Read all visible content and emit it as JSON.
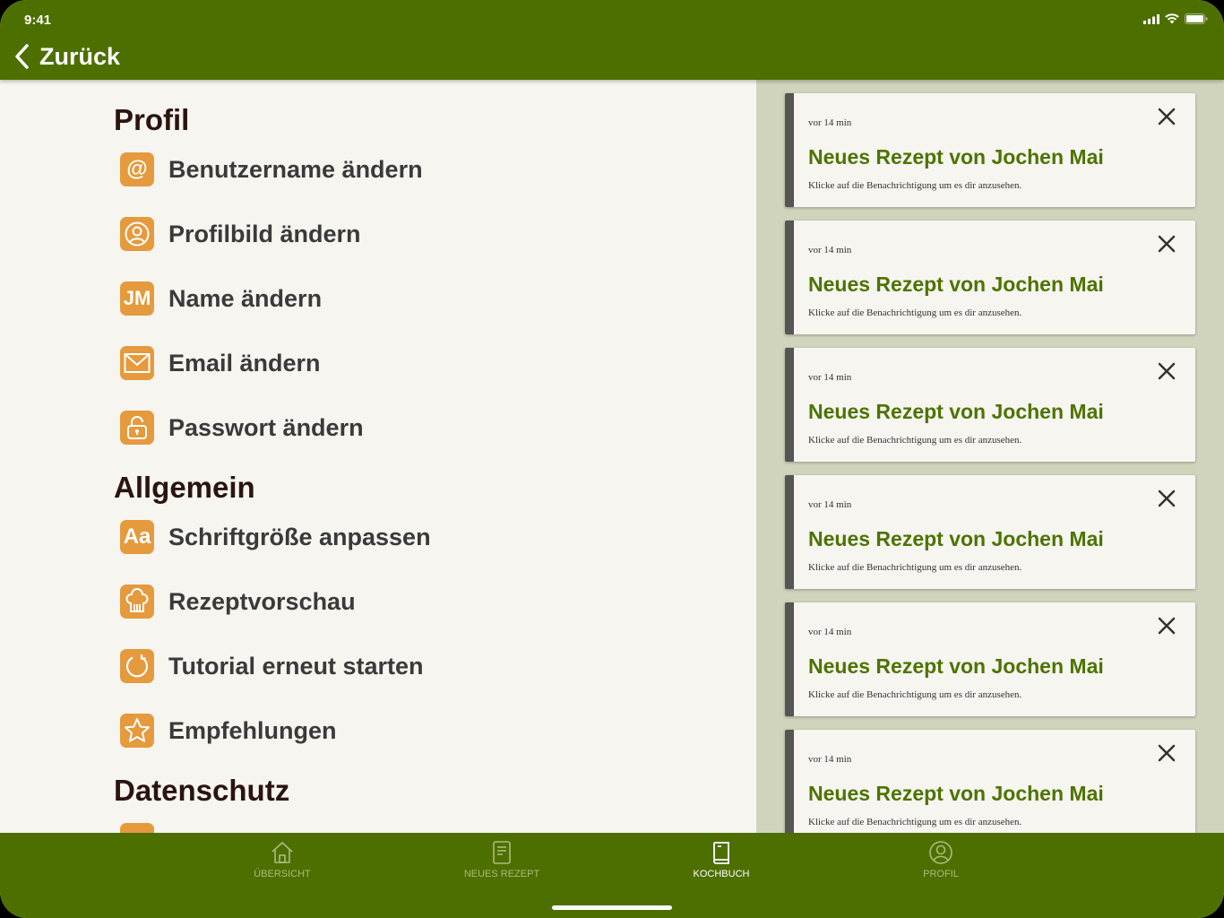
{
  "status_bar": {
    "time": "9:41"
  },
  "header": {
    "back_label": "Zurück"
  },
  "settings": {
    "sections": [
      {
        "title": "Profil"
      },
      {
        "title": "Allgemein"
      },
      {
        "title": "Datenschutz"
      }
    ],
    "items": [
      {
        "label": "Benutzername ändern",
        "icon": "at-icon",
        "glyph": "@"
      },
      {
        "label": "Profilbild ändern",
        "icon": "profile-picture-icon"
      },
      {
        "label": "Name ändern",
        "icon": "initials-icon",
        "glyph": "JM"
      },
      {
        "label": "Email ändern",
        "icon": "mail-icon"
      },
      {
        "label": "Passwort ändern",
        "icon": "lock-icon"
      },
      {
        "label": "Schriftgröße anpassen",
        "icon": "font-size-icon",
        "glyph": "Aa"
      },
      {
        "label": "Rezeptvorschau",
        "icon": "chef-hat-icon"
      },
      {
        "label": "Tutorial erneut starten",
        "icon": "restart-icon"
      },
      {
        "label": "Empfehlungen",
        "icon": "star-icon"
      }
    ]
  },
  "notifications": [
    {
      "time": "vor 14 min",
      "title": "Neues Rezept von Jochen Mai",
      "body": "Klicke auf die Benachrichtigung um es dir anzusehen."
    },
    {
      "time": "vor 14 min",
      "title": "Neues Rezept von Jochen Mai",
      "body": "Klicke auf die Benachrichtigung um es dir anzusehen."
    },
    {
      "time": "vor 14 min",
      "title": "Neues Rezept von Jochen Mai",
      "body": "Klicke auf die Benachrichtigung um es dir anzusehen."
    },
    {
      "time": "vor 14 min",
      "title": "Neues Rezept von Jochen Mai",
      "body": "Klicke auf die Benachrichtigung um es dir anzusehen."
    },
    {
      "time": "vor 14 min",
      "title": "Neues Rezept von Jochen Mai",
      "body": "Klicke auf die Benachrichtigung um es dir anzusehen."
    },
    {
      "time": "vor 14 min",
      "title": "Neues Rezept von Jochen Mai",
      "body": "Klicke auf die Benachrichtigung um es dir anzusehen."
    }
  ],
  "tabbar": {
    "tabs": [
      {
        "label": "ÜBERSICHT",
        "icon": "home-icon",
        "active": false
      },
      {
        "label": "NEUES REZEPT",
        "icon": "new-recipe-icon",
        "active": false
      },
      {
        "label": "KOCHBUCH",
        "icon": "cookbook-icon",
        "active": true
      },
      {
        "label": "PROFIL",
        "icon": "profile-icon",
        "active": false
      }
    ]
  },
  "colors": {
    "primary": "#4d6f00",
    "accent": "#e49a3d",
    "title_green": "#4d7300",
    "panel_bg": "#d0d4bc",
    "page_bg": "#f6f5f0"
  }
}
